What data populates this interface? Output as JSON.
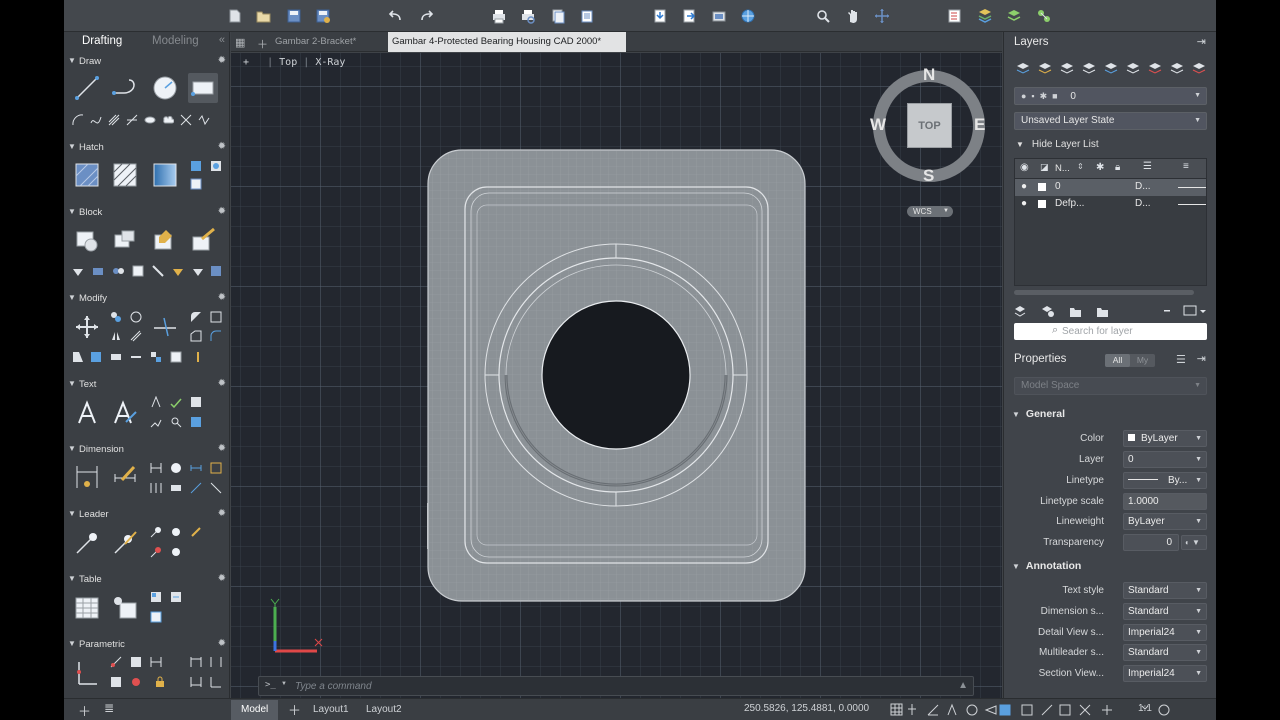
{
  "toolbar": {
    "icons": [
      "new-icon",
      "open-icon",
      "save-icon",
      "save-as-icon",
      "undo-icon",
      "redo-icon",
      "plot-icon",
      "plot-preview-icon",
      "publish-icon",
      "batch-plot-icon",
      "import-icon",
      "export-icon",
      "attach-icon",
      "web-icon",
      "zoom-icon",
      "pan-icon",
      "orbit-icon",
      "properties-icon",
      "layer-icon",
      "layer-state-icon",
      "plugin-icon"
    ]
  },
  "palette": {
    "tabs": {
      "active": "Drafting",
      "inactive": "Modeling",
      "collapse": "«"
    },
    "sections": [
      {
        "name": "Draw"
      },
      {
        "name": "Hatch"
      },
      {
        "name": "Block"
      },
      {
        "name": "Modify"
      },
      {
        "name": "Text"
      },
      {
        "name": "Dimension"
      },
      {
        "name": "Leader"
      },
      {
        "name": "Table"
      },
      {
        "name": "Parametric"
      }
    ]
  },
  "doc_tabs": {
    "tabs": [
      {
        "label": "Gambar 2-Bracket*",
        "active": false
      },
      {
        "label": "Gambar 4-Protected Bearing Housing CAD 2000*",
        "active": true
      }
    ]
  },
  "viewport": {
    "label_prefix": "+",
    "view": "Top",
    "style": "X-Ray",
    "viewcube": {
      "north": "N",
      "south": "S",
      "east": "E",
      "west": "W",
      "face": "TOP",
      "wcs": "WCS"
    },
    "ucs": {
      "y": "Y",
      "x": "X"
    }
  },
  "command": {
    "prompt": ">_",
    "placeholder": "Type a command"
  },
  "layers": {
    "title": "Layers",
    "current_layer": "0",
    "layer_state": "Unsaved Layer State",
    "hide_list": "Hide Layer List",
    "columns": {
      "name": "N...",
      "desc": ""
    },
    "rows": [
      {
        "name": "0",
        "linetype": "D...",
        "selected": true
      },
      {
        "name": "Defp...",
        "linetype": "D...",
        "selected": false
      }
    ],
    "search_placeholder": "Search for layer"
  },
  "properties": {
    "title": "Properties",
    "filter_all": "All",
    "filter_my": "My",
    "space": "Model Space",
    "general": {
      "heading": "General",
      "rows": [
        {
          "label": "Color",
          "value": "ByLayer"
        },
        {
          "label": "Layer",
          "value": "0"
        },
        {
          "label": "Linetype",
          "value": "By..."
        },
        {
          "label": "Linetype scale",
          "value": "1.0000"
        },
        {
          "label": "Lineweight",
          "value": "ByLayer"
        },
        {
          "label": "Transparency",
          "value": "0"
        }
      ]
    },
    "annotation": {
      "heading": "Annotation",
      "rows": [
        {
          "label": "Text style",
          "value": "Standard"
        },
        {
          "label": "Dimension s...",
          "value": "Standard"
        },
        {
          "label": "Detail View s...",
          "value": "Imperial24"
        },
        {
          "label": "Multileader s...",
          "value": "Standard"
        },
        {
          "label": "Section View...",
          "value": "Imperial24"
        }
      ]
    }
  },
  "statusbar": {
    "tabs": [
      {
        "label": "Model",
        "active": true
      },
      {
        "label": "Layout1",
        "active": false
      },
      {
        "label": "Layout2",
        "active": false
      }
    ],
    "coords": "250.5826, 125.4881, 0.0000",
    "scale": "1:1"
  },
  "colors": {
    "viewport_bg": "#23272f",
    "panel_bg": "#40444a",
    "part_fill": "#8d9398",
    "accent": "#4a90d9"
  }
}
